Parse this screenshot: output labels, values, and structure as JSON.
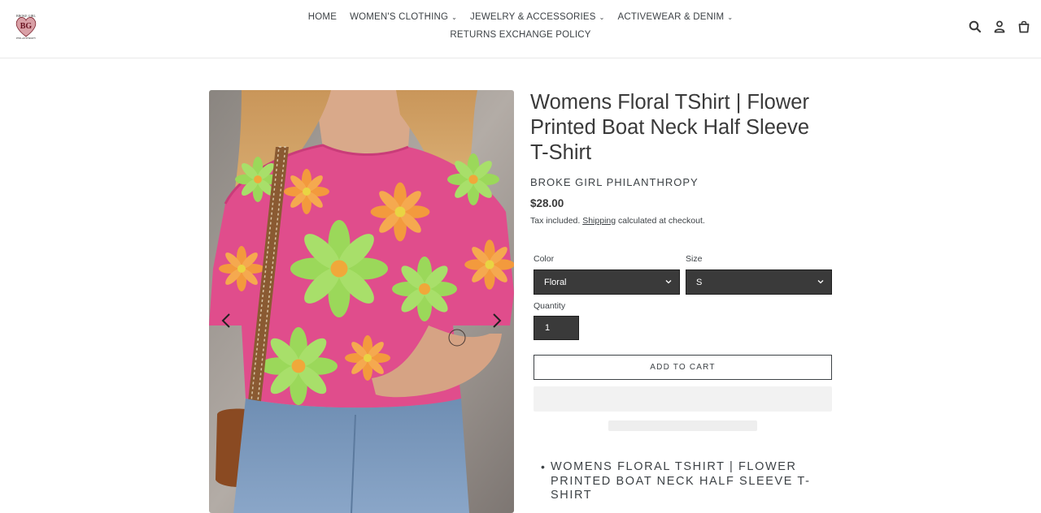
{
  "header": {
    "logo_text": "BROKE GIRL PHILANTHROPY BG",
    "nav_row1": [
      {
        "label": "HOME",
        "has_dropdown": false
      },
      {
        "label": "WOMEN'S CLOTHING",
        "has_dropdown": true
      },
      {
        "label": "JEWELRY & ACCESSORIES",
        "has_dropdown": true
      },
      {
        "label": "ACTIVEWEAR & DENIM",
        "has_dropdown": true
      }
    ],
    "nav_row2": [
      {
        "label": "RETURNS EXCHANGE POLICY",
        "has_dropdown": false
      }
    ],
    "icons": [
      "search-icon",
      "account-icon",
      "cart-icon"
    ]
  },
  "gallery": {
    "image_alt": "Woman wearing pink floral boat neck half sleeve t-shirt with jeans",
    "colors": {
      "shirt": "#e04d8c",
      "petal_orange": "#f39a3d",
      "petal_green": "#9bd85a",
      "denim": "#6b8bb0"
    }
  },
  "product": {
    "title": "Womens Floral TShirt | Flower Printed Boat Neck Half Sleeve T-Shirt",
    "vendor": "BROKE GIRL PHILANTHROPY",
    "price": "$28.00",
    "tax_prefix": "Tax included. ",
    "tax_link": "Shipping",
    "tax_suffix": " calculated at checkout.",
    "color_label": "Color",
    "color_value": "Floral",
    "size_label": "Size",
    "size_value": "S",
    "quantity_label": "Quantity",
    "quantity_value": "1",
    "add_to_cart": "ADD TO CART",
    "description_bullet": "•",
    "description": "WOMENS FLORAL TSHIRT | FLOWER PRINTED BOAT NECK HALF SLEEVE T-SHIRT"
  },
  "colors": {
    "select_bg": "#3a3a3a",
    "text": "#3a3a3a",
    "placeholder": "#f2f2f2"
  }
}
